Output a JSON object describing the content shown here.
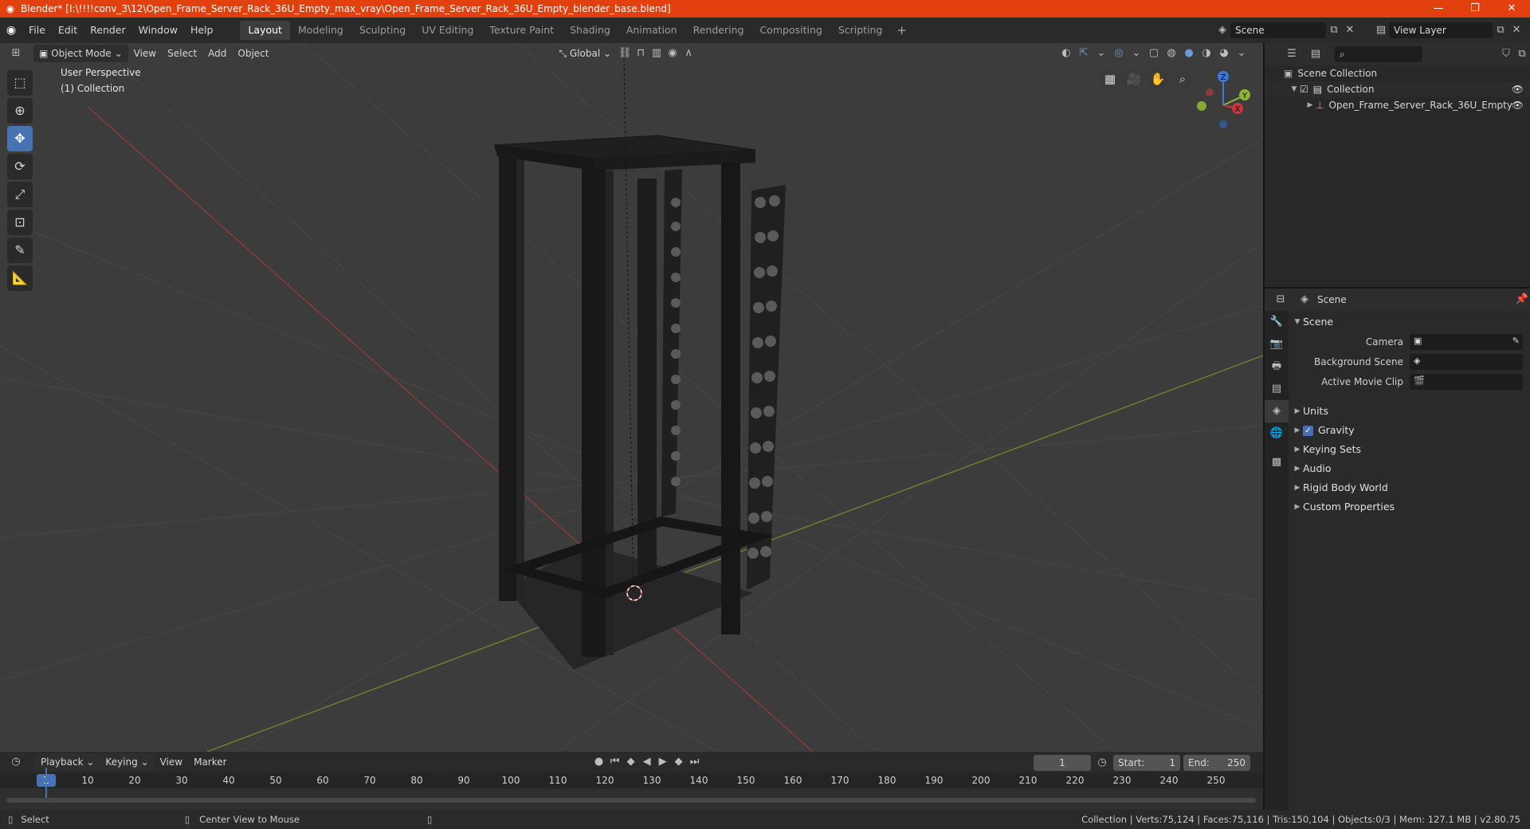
{
  "window": {
    "title": "Blender* [I:\\!!!!conv_3\\12\\Open_Frame_Server_Rack_36U_Empty_max_vray\\Open_Frame_Server_Rack_36U_Empty_blender_base.blend]",
    "minimize": "—",
    "restore": "❐",
    "close": "✕"
  },
  "menu": [
    "File",
    "Edit",
    "Render",
    "Window",
    "Help"
  ],
  "workspaces": [
    "Layout",
    "Modeling",
    "Sculpting",
    "UV Editing",
    "Texture Paint",
    "Shading",
    "Animation",
    "Rendering",
    "Compositing",
    "Scripting"
  ],
  "scene_selector": {
    "label": "Scene"
  },
  "viewlayer_selector": {
    "label": "View Layer"
  },
  "viewport": {
    "mode": "Object Mode",
    "menus": [
      "View",
      "Select",
      "Add",
      "Object"
    ],
    "transform_orientation": "Global",
    "overlay_title": "User Perspective",
    "overlay_collection": "(1) Collection",
    "gizmo_axes": {
      "x": "X",
      "y": "Y",
      "z": "Z"
    }
  },
  "outliner": {
    "root": "Scene Collection",
    "collection": "Collection",
    "object": "Open_Frame_Server_Rack_36U_Empty"
  },
  "properties": {
    "context": "Scene",
    "panel_title": "Scene",
    "camera_label": "Camera",
    "background_scene_label": "Background Scene",
    "active_movie_clip_label": "Active Movie Clip",
    "subpanels": [
      "Units",
      "Gravity",
      "Keying Sets",
      "Audio",
      "Rigid Body World",
      "Custom Properties"
    ]
  },
  "timeline": {
    "menus": [
      "Playback",
      "Keying",
      "View",
      "Marker"
    ],
    "current_frame": "1",
    "start_label": "Start:",
    "start": "1",
    "end_label": "End:",
    "end": "250",
    "ticks": [
      "1",
      "10",
      "20",
      "30",
      "40",
      "50",
      "60",
      "70",
      "80",
      "90",
      "100",
      "110",
      "120",
      "130",
      "140",
      "150",
      "160",
      "170",
      "180",
      "190",
      "200",
      "210",
      "220",
      "230",
      "240",
      "250"
    ]
  },
  "status": {
    "select": "Select",
    "center_view": "Center View to Mouse",
    "stats": "Collection | Verts:75,124 | Faces:75,116 | Tris:150,104 | Objects:0/3 | Mem: 127.1 MB | v2.80.75"
  },
  "colors": {
    "title_bar": "#e2400e",
    "accent": "#4772b3",
    "x_axis": "#c8363e",
    "y_axis": "#8db537",
    "z_axis": "#3b7ad8"
  }
}
